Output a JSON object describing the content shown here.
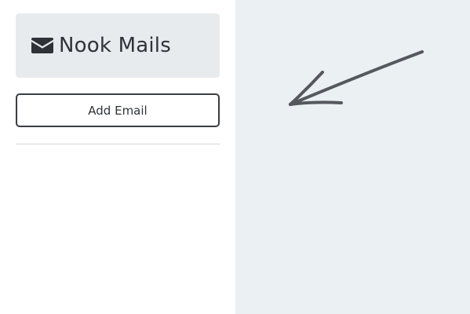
{
  "app": {
    "title": "Nook Mails",
    "brand_icon": "envelope-icon"
  },
  "sidebar": {
    "add_button_label": "Add Email"
  },
  "main": {
    "hint_icon": "hand-drawn-arrow-icon"
  },
  "colors": {
    "brand_bg": "#e8ebee",
    "main_bg": "#ebf0f3",
    "text": "#2f3338",
    "arrow": "#55585c"
  }
}
